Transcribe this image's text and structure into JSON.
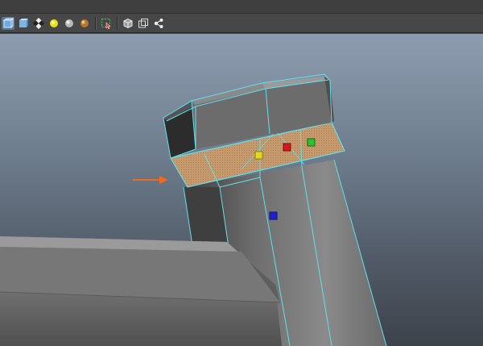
{
  "toolbar": {
    "buttons": [
      {
        "icon": "wireframe-on-shaded-icon",
        "active": true
      },
      {
        "icon": "smooth-shade-cube-icon",
        "active": false
      },
      {
        "icon": "textured-checker-icon",
        "active": false
      },
      {
        "icon": "use-all-lights-icon",
        "active": false
      },
      {
        "icon": "shadows-sphere-icon",
        "active": false
      },
      {
        "icon": "ambient-occlusion-sphere-icon",
        "active": false
      },
      {
        "icon": "isolate-select-icon",
        "active": false
      },
      {
        "icon": "xray-cube-icon",
        "active": false
      },
      {
        "icon": "xray-joints-icon",
        "active": false
      },
      {
        "icon": "node-graph-icon",
        "active": false
      }
    ]
  },
  "viewport": {
    "selection_color": "#c69a6c",
    "wire_color": "#5fe1ef",
    "arrow_color": "#ef6a1c",
    "manipulator_handles": [
      "yellow",
      "red",
      "green",
      "blue"
    ]
  }
}
